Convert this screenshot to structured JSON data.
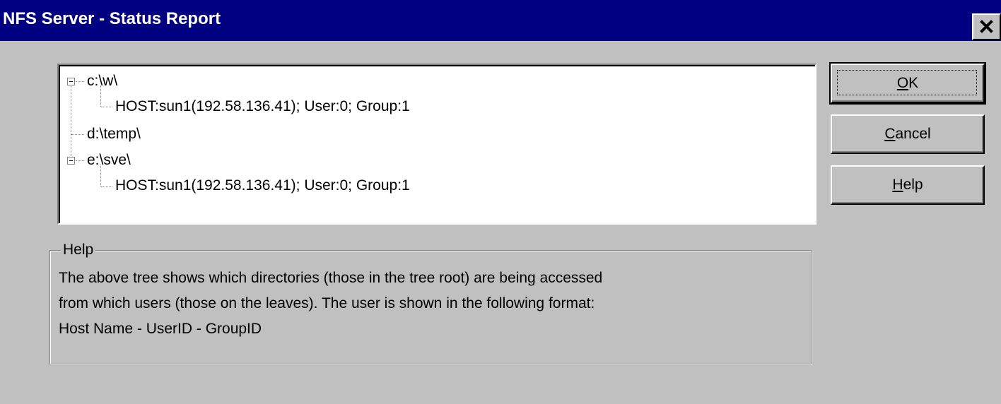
{
  "window": {
    "title": "NFS Server - Status Report",
    "close_glyph": "×"
  },
  "tree": {
    "nodes": [
      {
        "label": "c:\\w\\",
        "expanded": true,
        "children": [
          {
            "label": "HOST:sun1(192.58.136.41); User:0; Group:1"
          }
        ]
      },
      {
        "label": "d:\\temp\\",
        "expanded": false,
        "children": []
      },
      {
        "label": "e:\\sve\\",
        "expanded": true,
        "children": [
          {
            "label": "HOST:sun1(192.58.136.41); User:0; Group:1"
          }
        ]
      }
    ]
  },
  "buttons": {
    "ok": {
      "mnemonic": "O",
      "rest": "K"
    },
    "cancel": {
      "mnemonic": "C",
      "rest": "ancel"
    },
    "help": {
      "mnemonic": "H",
      "rest": "elp"
    }
  },
  "help_group": {
    "label": "Help",
    "lines": [
      "The above tree shows which directories (those in the tree root) are being accessed",
      "from which users (those on the leaves). The user is shown in the following format:",
      "Host Name - UserID - GroupID"
    ]
  },
  "icons": {
    "close": "close-icon",
    "expander": "minus-box-icon"
  },
  "colors": {
    "titlebar": "#000080",
    "face": "#c0c0c0"
  }
}
